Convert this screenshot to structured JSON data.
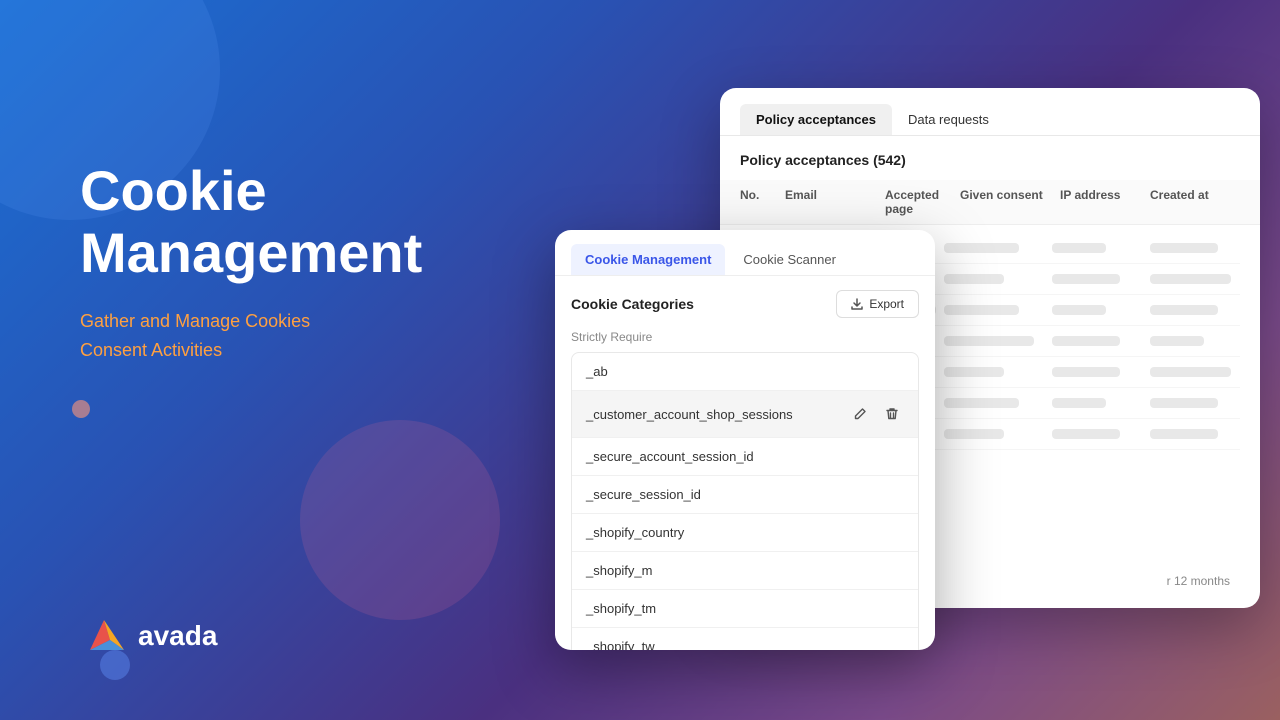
{
  "background": {
    "gradient_start": "#1a6fd4",
    "gradient_end": "#9a6060"
  },
  "left": {
    "title_line1": "Cookie",
    "title_line2": "Management",
    "subtitle_line1": "Gather and Manage Cookies",
    "subtitle_line2": "Consent Activities",
    "logo_text": "avada"
  },
  "policy_panel": {
    "tab1": "Policy acceptances",
    "tab2": "Data requests",
    "header": "Policy acceptances (542)",
    "columns": {
      "no": "No.",
      "email": "Email",
      "accepted_page": "Accepted page",
      "given_consent": "Given consent",
      "ip_address": "IP address",
      "created_at": "Created at"
    },
    "footer_text": "r 12 months"
  },
  "cookie_panel": {
    "tab1": "Cookie Management",
    "tab2": "Cookie Scanner",
    "categories_title": "Cookie Categories",
    "export_label": "Export",
    "section_label": "Strictly Require",
    "cookies": [
      "_ab",
      "_customer_account_shop_sessions",
      "_secure_account_session_id",
      "_secure_session_id",
      "_shopify_country",
      "_shopify_m",
      "_shopify_tm",
      "_shopify_tw"
    ],
    "highlighted_index": 1
  }
}
